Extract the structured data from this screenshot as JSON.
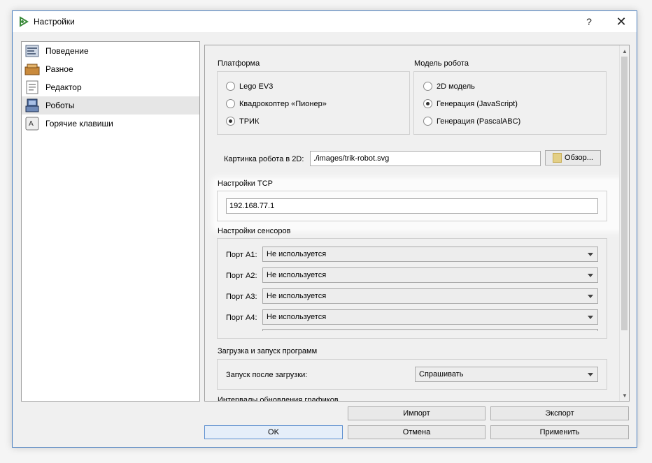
{
  "window": {
    "title": "Настройки",
    "help_glyph": "?",
    "close_glyph": "✕"
  },
  "sidebar": {
    "items": [
      {
        "label": "Поведение",
        "icon": "behavior-icon"
      },
      {
        "label": "Разное",
        "icon": "misc-icon"
      },
      {
        "label": "Редактор",
        "icon": "editor-icon"
      },
      {
        "label": "Роботы",
        "icon": "robots-icon",
        "selected": true
      },
      {
        "label": "Горячие клавиши",
        "icon": "hotkeys-icon"
      }
    ]
  },
  "platform": {
    "title": "Платформа",
    "options": [
      {
        "label": "Lego EV3",
        "checked": false
      },
      {
        "label": "Квадрокоптер «Пионер»",
        "checked": false
      },
      {
        "label": "ТРИК",
        "checked": true
      }
    ]
  },
  "robot_model": {
    "title": "Модель робота",
    "options": [
      {
        "label": "2D модель",
        "checked": false
      },
      {
        "label": "Генерация (JavaScript)",
        "checked": true
      },
      {
        "label": "Генерация (PascalABC)",
        "checked": false
      }
    ]
  },
  "image2d": {
    "label": "Картинка робота в 2D:",
    "value": "./images/trik-robot.svg",
    "browse_label": "Обзор..."
  },
  "tcp": {
    "title": "Настройки TCP",
    "value": "192.168.77.1"
  },
  "sensors": {
    "title": "Настройки сенсоров",
    "ports": [
      {
        "label": "Порт A1:",
        "value": "Не используется"
      },
      {
        "label": "Порт A2:",
        "value": "Не используется"
      },
      {
        "label": "Порт A3:",
        "value": "Не используется"
      },
      {
        "label": "Порт A4:",
        "value": "Не используется"
      }
    ]
  },
  "upload": {
    "title": "Загрузка и запуск программ",
    "run_label": "Запуск после загрузки:",
    "run_value": "Спрашивать"
  },
  "graphs": {
    "title": "Интервалы обновления графиков"
  },
  "buttons": {
    "import": "Импорт",
    "export": "Экспорт",
    "ok": "OK",
    "cancel": "Отмена",
    "apply": "Применить"
  }
}
